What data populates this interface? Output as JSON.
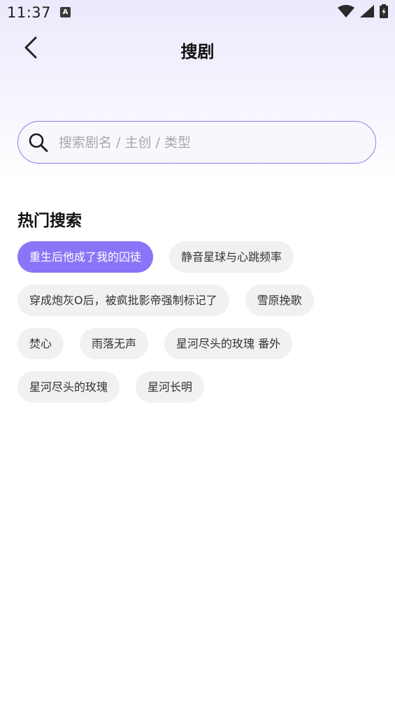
{
  "status_bar": {
    "time": "11:37",
    "notification_icon": "A"
  },
  "header": {
    "title": "搜剧",
    "back_icon": "chevron-left-icon"
  },
  "search": {
    "placeholder": "搜索剧名 / 主创 / 类型",
    "value": "",
    "icon": "search-icon"
  },
  "hot_search": {
    "title": "热门搜索",
    "rows": [
      [
        {
          "label": "重生后他成了我的囚徒",
          "active": true
        },
        {
          "label": "静音星球与心跳频率",
          "active": false
        }
      ],
      [
        {
          "label": "穿成炮灰O后，被疯批影帝强制标记了",
          "active": false
        },
        {
          "label": "雪原挽歌",
          "active": false
        }
      ],
      [
        {
          "label": "焚心",
          "active": false
        },
        {
          "label": "雨落无声",
          "active": false
        },
        {
          "label": "星河尽头的玫瑰 番外",
          "active": false
        }
      ],
      [
        {
          "label": "星河尽头的玫瑰",
          "active": false
        },
        {
          "label": "星河长明",
          "active": false
        }
      ]
    ]
  },
  "colors": {
    "accent": "#8a74f7",
    "search_border": "#8b7ff0",
    "tag_bg": "#f1f1f3"
  }
}
